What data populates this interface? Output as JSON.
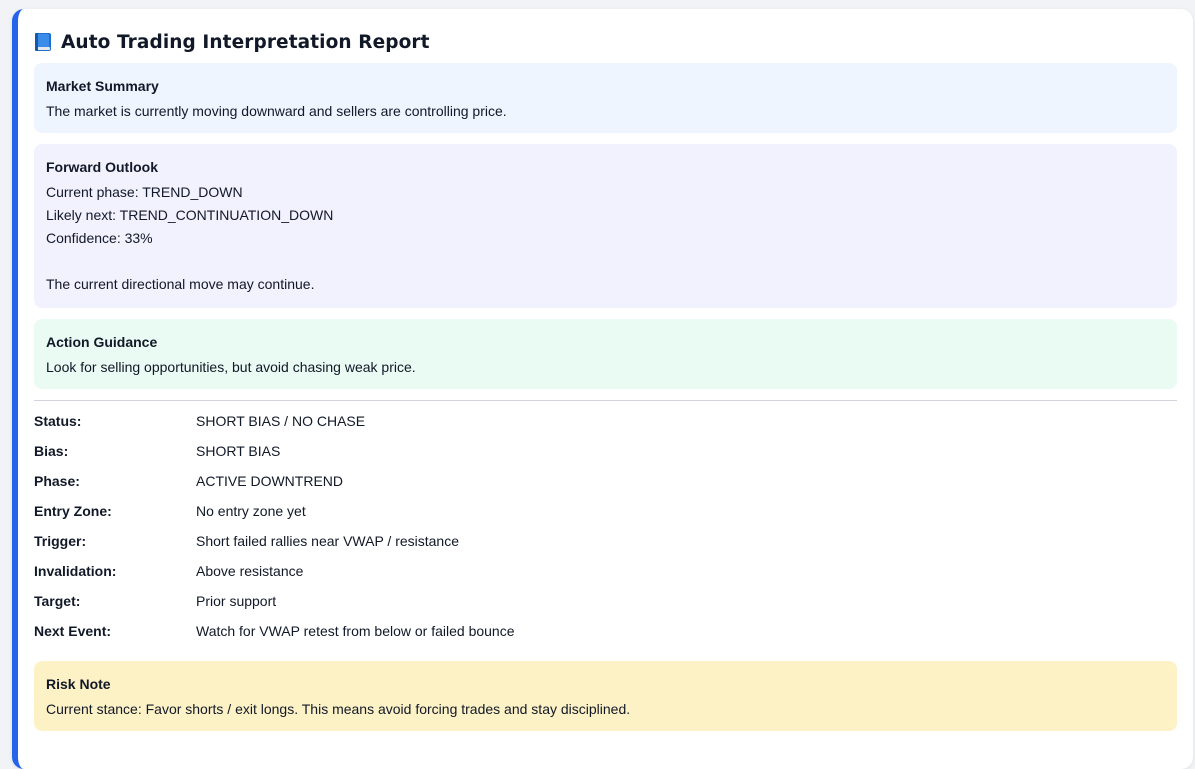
{
  "report": {
    "title": "Auto Trading Interpretation Report",
    "title_icon": "blue-book-icon",
    "accent_color": "#2563eb"
  },
  "market_summary": {
    "heading": "Market Summary",
    "text": "The market is currently moving downward and sellers are controlling price.",
    "background": "#eef5ff"
  },
  "forward_outlook": {
    "heading": "Forward Outlook",
    "current_phase": "Current phase: TREND_DOWN",
    "likely_next": "Likely next: TREND_CONTINUATION_DOWN",
    "confidence": "Confidence: 33%",
    "note": "The current directional move may continue.",
    "background": "#f2f1fe"
  },
  "action_guidance": {
    "heading": "Action Guidance",
    "text": "Look for selling opportunities, but avoid chasing weak price.",
    "background": "#eafbf3"
  },
  "details": [
    {
      "label": "Status:",
      "value": "SHORT BIAS / NO CHASE"
    },
    {
      "label": "Bias:",
      "value": "SHORT BIAS"
    },
    {
      "label": "Phase:",
      "value": "ACTIVE DOWNTREND"
    },
    {
      "label": "Entry Zone:",
      "value": "No entry zone yet"
    },
    {
      "label": "Trigger:",
      "value": "Short failed rallies near VWAP / resistance"
    },
    {
      "label": "Invalidation:",
      "value": "Above resistance"
    },
    {
      "label": "Target:",
      "value": "Prior support"
    },
    {
      "label": "Next Event:",
      "value": "Watch for VWAP retest from below or failed bounce"
    }
  ],
  "risk_note": {
    "heading": "Risk Note",
    "text": "Current stance: Favor shorts / exit longs. This means avoid forcing trades and stay disciplined.",
    "background": "#fdf2c6"
  }
}
